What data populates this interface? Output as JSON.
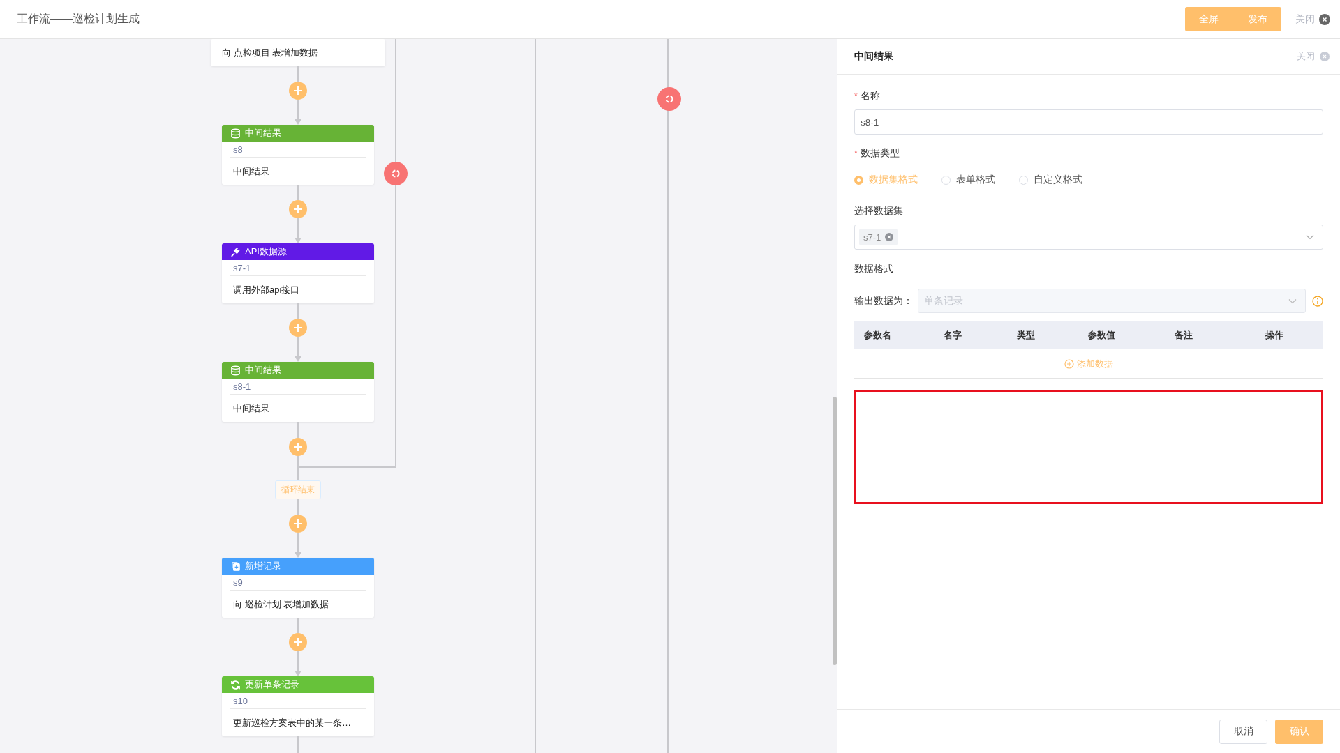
{
  "window": {
    "title": "工作流——巡检计划生成",
    "buttons": [
      {
        "label": "全屏",
        "kind": "primary"
      },
      {
        "label": "发布",
        "kind": "primary"
      }
    ],
    "close": "关闭"
  },
  "canvas": {
    "steps": [
      {
        "kind": "partial_card",
        "description": "向 点检项目 表增加数据"
      },
      {
        "kind": "intermediate",
        "title": "中间结果",
        "id": "s8",
        "description": "中间结果"
      },
      {
        "kind": "api",
        "title": "API数据源",
        "id": "s7-1",
        "description": "调用外部api接口"
      },
      {
        "kind": "intermediate",
        "title": "中间结果",
        "id": "s8-1",
        "description": "中间结果"
      },
      {
        "kind": "loop_end",
        "label": "循环结束"
      },
      {
        "kind": "add_record",
        "title": "新增记录",
        "id": "s9",
        "description": "向 巡检计划 表增加数据"
      },
      {
        "kind": "update",
        "title": "更新单条记录",
        "id": "s10",
        "description": "更新巡检方案表中的某一条…"
      }
    ]
  },
  "panel": {
    "title": "中间结果",
    "close": "关闭",
    "name_field": {
      "mark": "*",
      "label": "名称",
      "value": "s8-1"
    },
    "data_type": {
      "mark": "*",
      "label": "数据类型",
      "options": [
        {
          "label": "数据集格式",
          "selected": true
        },
        {
          "label": "表单格式",
          "selected": false
        },
        {
          "label": "自定义格式",
          "selected": false
        }
      ]
    },
    "dataset": {
      "label": "选择数据集",
      "tags": [
        "s7-1"
      ]
    },
    "format_section": "数据格式",
    "output": {
      "label": "输出数据为：",
      "placeholder": "单条记录",
      "disabled": true
    },
    "table": {
      "columns": [
        "参数名",
        "名字",
        "类型",
        "参数值",
        "备注",
        "操作"
      ],
      "add_link": "添加数据"
    },
    "buttons": [
      {
        "label": "取消",
        "kind": "secondary"
      },
      {
        "label": "确认",
        "kind": "primary"
      }
    ]
  }
}
